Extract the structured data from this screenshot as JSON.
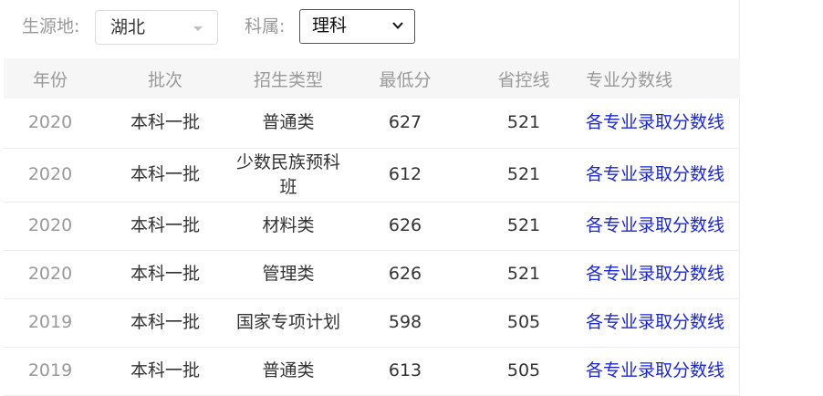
{
  "filters": {
    "source_label": "生源地:",
    "source_value": "湖北",
    "category_label": "科属:",
    "category_value": "理科"
  },
  "table": {
    "headers": [
      "年份",
      "批次",
      "招生类型",
      "最低分",
      "省控线",
      "专业分数线"
    ],
    "rows": [
      {
        "year": "2020",
        "batch": "本科一批",
        "type": "普通类",
        "min": "627",
        "prov": "521",
        "link": "各专业录取分数线"
      },
      {
        "year": "2020",
        "batch": "本科一批",
        "type": "少数民族预科班",
        "min": "612",
        "prov": "521",
        "link": "各专业录取分数线"
      },
      {
        "year": "2020",
        "batch": "本科一批",
        "type": "材料类",
        "min": "626",
        "prov": "521",
        "link": "各专业录取分数线"
      },
      {
        "year": "2020",
        "batch": "本科一批",
        "type": "管理类",
        "min": "626",
        "prov": "521",
        "link": "各专业录取分数线"
      },
      {
        "year": "2019",
        "batch": "本科一批",
        "type": "国家专项计划",
        "min": "598",
        "prov": "505",
        "link": "各专业录取分数线"
      },
      {
        "year": "2019",
        "batch": "本科一批",
        "type": "普通类",
        "min": "613",
        "prov": "505",
        "link": "各专业录取分数线"
      }
    ]
  },
  "colors": {
    "link": "#1a27d6",
    "muted": "#999999",
    "header_bg": "#f6f6f6"
  },
  "icons": {
    "source_caret": "caret-down-icon",
    "category_chevron": "chevron-down-icon"
  }
}
